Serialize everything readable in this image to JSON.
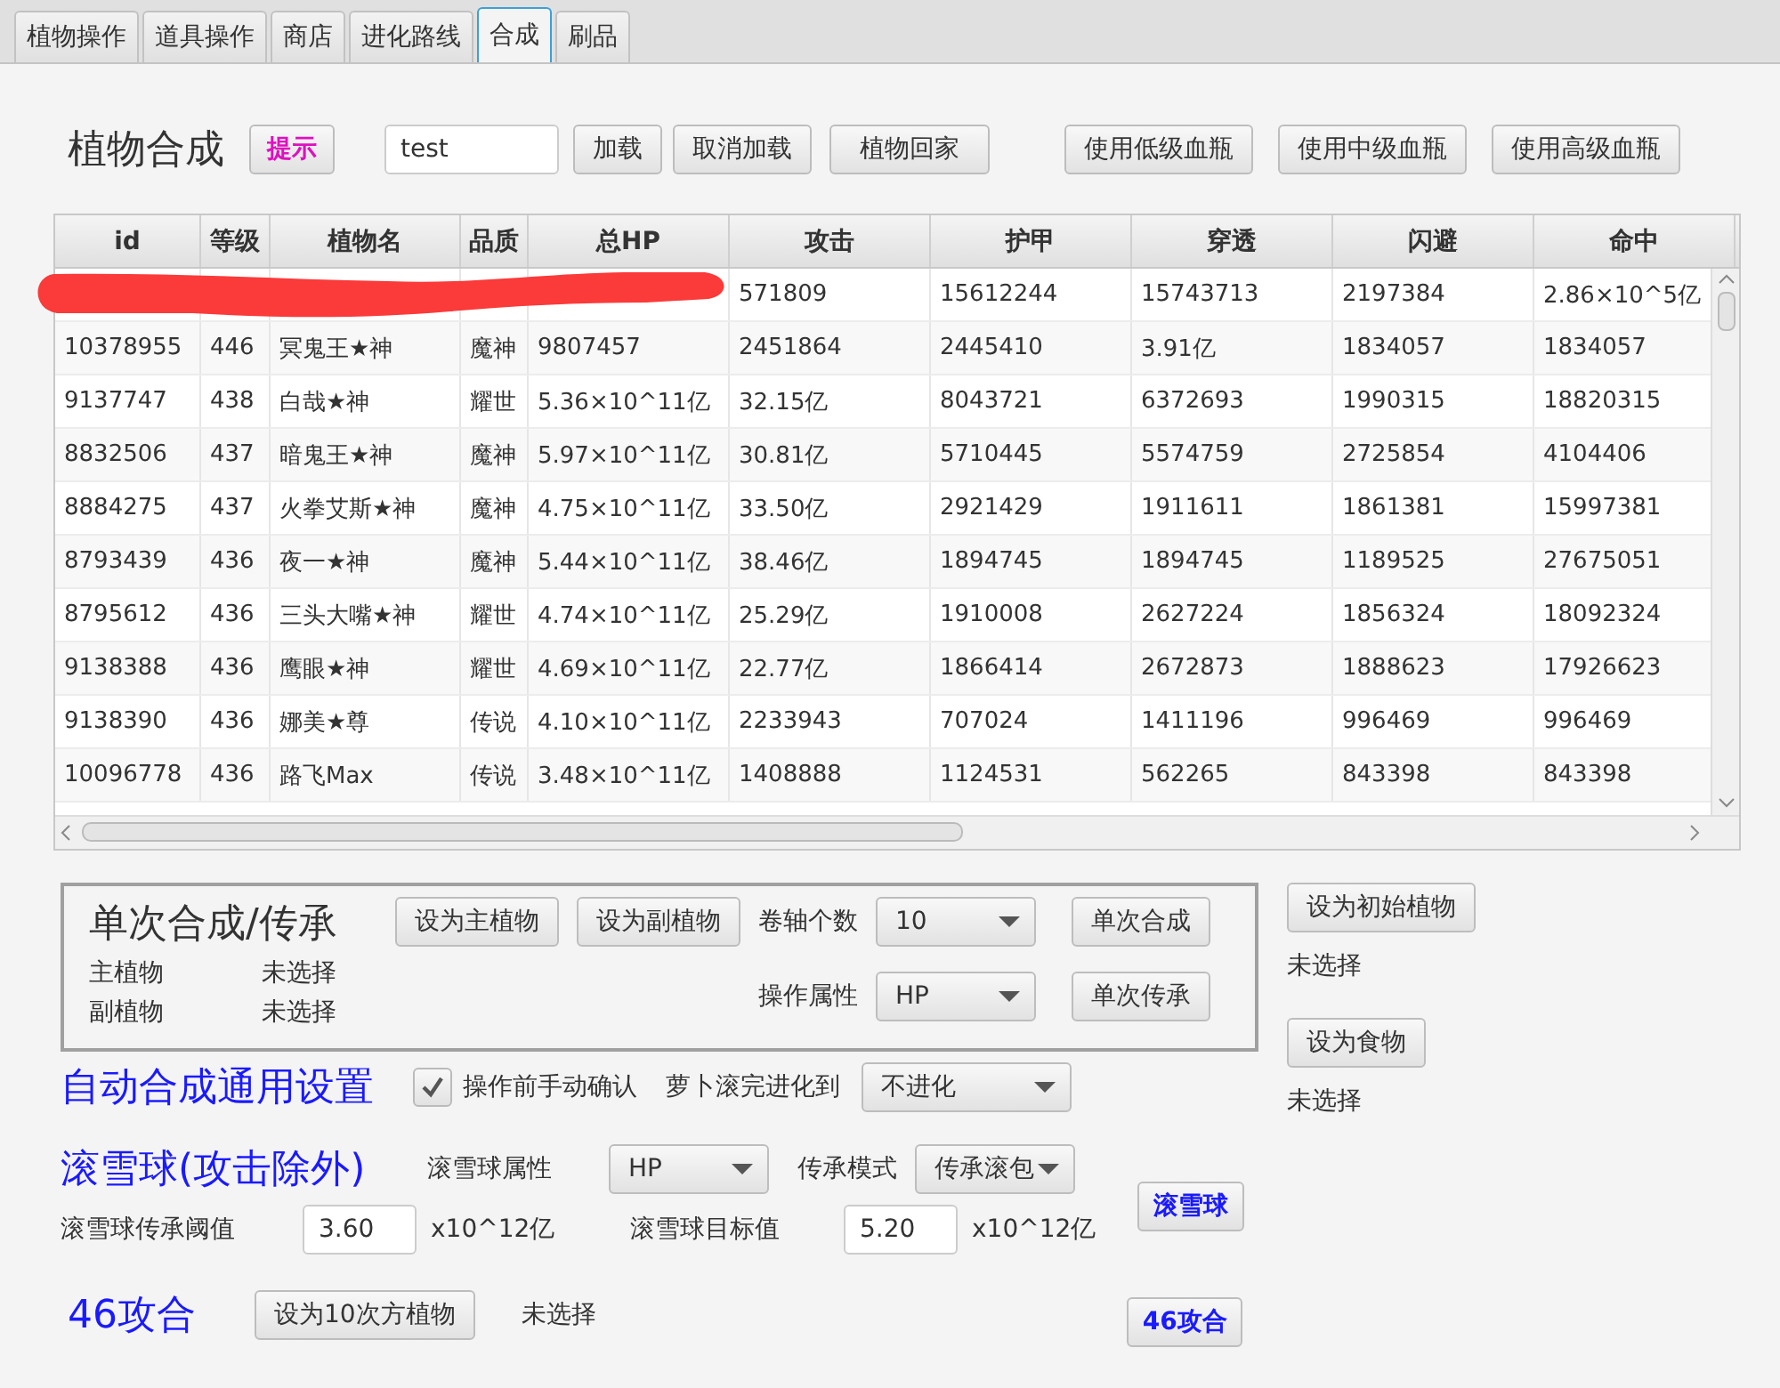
{
  "tabs": [
    {
      "label": "植物操作",
      "selected": false
    },
    {
      "label": "道具操作",
      "selected": false
    },
    {
      "label": "商店",
      "selected": false
    },
    {
      "label": "进化路线",
      "selected": false
    },
    {
      "label": "合成",
      "selected": true
    },
    {
      "label": "刷品",
      "selected": false
    }
  ],
  "header": {
    "title": "植物合成",
    "hint_button": "提示",
    "search": {
      "value": "test"
    },
    "buttons": [
      "加载",
      "取消加载",
      "植物回家"
    ],
    "potion_buttons": [
      "使用低级血瓶",
      "使用中级血瓶",
      "使用高级血瓶"
    ]
  },
  "table": {
    "columns": [
      "id",
      "等级",
      "植物名",
      "品质",
      "总HP",
      "攻击",
      "护甲",
      "穿透",
      "闪避",
      "命中"
    ],
    "rows": [
      {
        "redacted": true,
        "cells": [
          "",
          "",
          "",
          "",
          "",
          "571809",
          "15612244",
          "15743713",
          "2197384",
          "2.86×10^5亿"
        ]
      },
      {
        "redacted": false,
        "cells": [
          "10378955",
          "446",
          "冥鬼王★神",
          "魔神",
          "9807457",
          "2451864",
          "2445410",
          "3.91亿",
          "1834057",
          "1834057"
        ]
      },
      {
        "redacted": false,
        "cells": [
          "9137747",
          "438",
          "白哉★神",
          "耀世",
          "5.36×10^11亿",
          "32.15亿",
          "8043721",
          "6372693",
          "1990315",
          "18820315"
        ]
      },
      {
        "redacted": false,
        "cells": [
          "8832506",
          "437",
          "暗鬼王★神",
          "魔神",
          "5.97×10^11亿",
          "30.81亿",
          "5710445",
          "5574759",
          "2725854",
          "4104406"
        ]
      },
      {
        "redacted": false,
        "cells": [
          "8884275",
          "437",
          "火拳艾斯★神",
          "魔神",
          "4.75×10^11亿",
          "33.50亿",
          "2921429",
          "1911611",
          "1861381",
          "15997381"
        ]
      },
      {
        "redacted": false,
        "cells": [
          "8793439",
          "436",
          "夜一★神",
          "魔神",
          "5.44×10^11亿",
          "38.46亿",
          "1894745",
          "1894745",
          "1189525",
          "27675051"
        ]
      },
      {
        "redacted": false,
        "cells": [
          "8795612",
          "436",
          "三头大嘴★神",
          "耀世",
          "4.74×10^11亿",
          "25.29亿",
          "1910008",
          "2627224",
          "1856324",
          "18092324"
        ]
      },
      {
        "redacted": false,
        "cells": [
          "9138388",
          "436",
          "鹰眼★神",
          "耀世",
          "4.69×10^11亿",
          "22.77亿",
          "1866414",
          "2672873",
          "1888623",
          "17926623"
        ]
      },
      {
        "redacted": false,
        "cells": [
          "9138390",
          "436",
          "娜美★尊",
          "传说",
          "4.10×10^11亿",
          "2233943",
          "707024",
          "1411196",
          "996469",
          "996469"
        ]
      },
      {
        "redacted": false,
        "cells": [
          "10096778",
          "436",
          "路飞Max",
          "传说",
          "3.48×10^11亿",
          "1408888",
          "1124531",
          "562265",
          "843398",
          "843398"
        ]
      }
    ]
  },
  "single": {
    "title": "单次合成/传承",
    "set_buttons": [
      "设为主植物",
      "设为副植物"
    ],
    "scroll_label": "卷轴个数",
    "scroll_count": "10",
    "synth_button": "单次合成",
    "fields": [
      {
        "label": "主植物",
        "value": "未选择"
      },
      {
        "label": "副植物",
        "value": "未选择"
      }
    ],
    "attr_label": "操作属性",
    "attr_value": "HP",
    "inherit_button": "单次传承"
  },
  "side": [
    {
      "button": "设为初始植物",
      "status": "未选择"
    },
    {
      "button": "设为食物",
      "status": "未选择"
    }
  ],
  "auto": {
    "title": "自动合成通用设置",
    "confirm": {
      "label": "操作前手动确认",
      "checked": true
    },
    "evolve_label": "萝卜滚完进化到",
    "evolve_value": "不进化"
  },
  "snowball": {
    "title": "滚雪球(攻击除外)",
    "attr_label": "滚雪球属性",
    "attr_value": "HP",
    "mode_label": "传承模式",
    "mode_value": "传承滚包",
    "threshold_label": "滚雪球传承阈值",
    "threshold_value": "3.60",
    "threshold_unit": "x10^12亿",
    "target_label": "滚雪球目标值",
    "target_value": "5.20",
    "target_unit": "x10^12亿",
    "button": "滚雪球"
  },
  "gong46": {
    "title": "46攻合",
    "button": "设为10次方植物",
    "status": "未选择",
    "run_button": "46攻合"
  }
}
